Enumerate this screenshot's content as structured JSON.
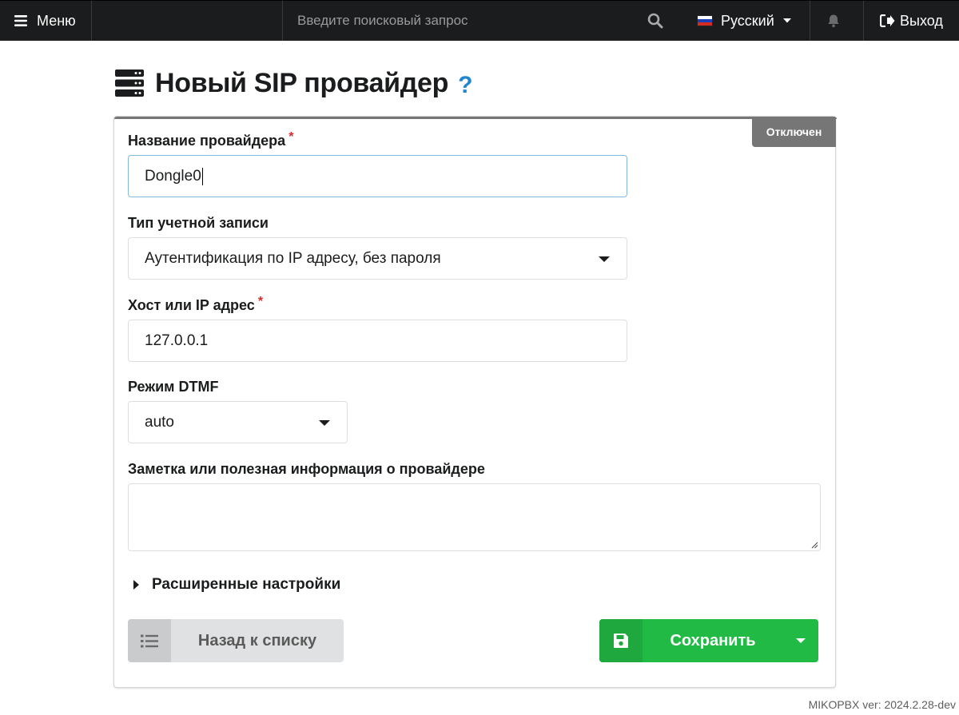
{
  "topbar": {
    "menu_label": "Меню",
    "search_placeholder": "Введите поисковый запрос",
    "language": "Русский",
    "logout_label": "Выход"
  },
  "page": {
    "title": "Новый SIP провайдер",
    "help": "?"
  },
  "form": {
    "status_badge": "Отключен",
    "provider_name_label": "Название провайдера",
    "provider_name_value": "Dongle0",
    "account_type_label": "Тип учетной записи",
    "account_type_value": "Аутентификация по IP адресу, без пароля",
    "host_label": "Хост или IP адрес",
    "host_value": "127.0.0.1",
    "dtmf_label": "Режим DTMF",
    "dtmf_value": "auto",
    "note_label": "Заметка или полезная информация о провайдере",
    "note_value": "",
    "advanced_label": "Расширенные настройки",
    "required_mark": "*"
  },
  "buttons": {
    "back_label": "Назад к списку",
    "save_label": "Сохранить"
  },
  "footer": {
    "version": "MIKOPBX ver: 2024.2.28-dev"
  },
  "colors": {
    "topbar": "#1b1c1d",
    "accent_help": "#2185d0",
    "save": "#21ba45",
    "status": "#767676",
    "required": "#db2828"
  },
  "icons": [
    "bars-icon",
    "search-icon",
    "flag-ru-icon",
    "chevron-down-icon",
    "bell-icon",
    "sign-out-icon",
    "server-icon",
    "question-icon",
    "list-icon",
    "save-icon",
    "caret-right-icon"
  ]
}
